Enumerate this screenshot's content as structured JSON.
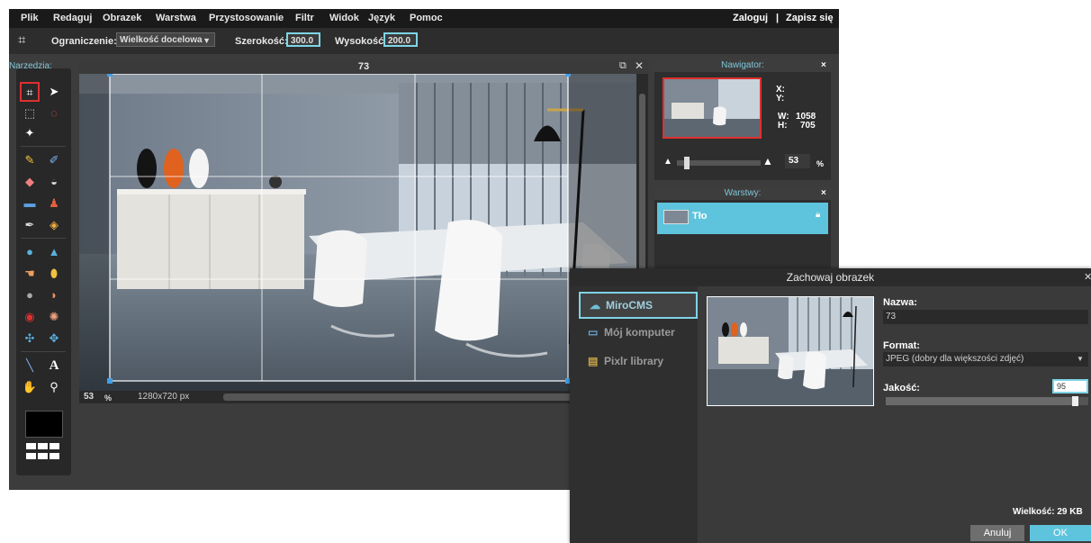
{
  "menu": [
    "Plik",
    "Redaguj",
    "Obrazek",
    "Warstwa",
    "Przystosowanie",
    "Filtr",
    "Widok",
    "Język",
    "Pomoc"
  ],
  "account": {
    "login": "Zaloguj",
    "separator": "|",
    "signup": "Zapisz się"
  },
  "options": {
    "constraint_label": "Ograniczenie:",
    "constraint_value": "Wielkość docelowa",
    "width_label": "Szerokość:",
    "width_value": "300.0",
    "height_label": "Wysokość:",
    "height_value": "200.0"
  },
  "tools": {
    "title": "Narzędzia:"
  },
  "canvas": {
    "title": "73",
    "zoom": "53",
    "zoom_unit": "%",
    "size": "1280x720 px"
  },
  "navigator": {
    "title": "Nawigator:",
    "close": "×",
    "x_label": "X:",
    "y_label": "Y:",
    "w_label": "W:",
    "w_value": "1058",
    "h_label": "H:",
    "h_value": "705",
    "zoom": "53",
    "zoom_unit": "%"
  },
  "layers": {
    "title": "Warstwy:",
    "close": "×",
    "items": [
      {
        "name": "Tło"
      }
    ]
  },
  "dialog": {
    "title": "Zachowaj obrazek",
    "destinations": [
      {
        "label": "MiroCMS",
        "selected": true
      },
      {
        "label": "Mój komputer",
        "selected": false
      },
      {
        "label": "Pixlr library",
        "selected": false
      }
    ],
    "name_label": "Nazwa:",
    "name_value": "73",
    "format_label": "Format:",
    "format_value": "JPEG (dobry dla większości zdjęć)",
    "quality_label": "Jakość:",
    "quality_value": "95",
    "quality_level": 0.95,
    "size_text": "Wielkość: 29 KB",
    "cancel": "Anuluj",
    "ok": "OK"
  },
  "colors": {
    "accent": "#7fd4e6",
    "layer_selected": "#5ec3dc",
    "ok_button": "#5ec3dc",
    "crop_frame": "#ffffff"
  }
}
